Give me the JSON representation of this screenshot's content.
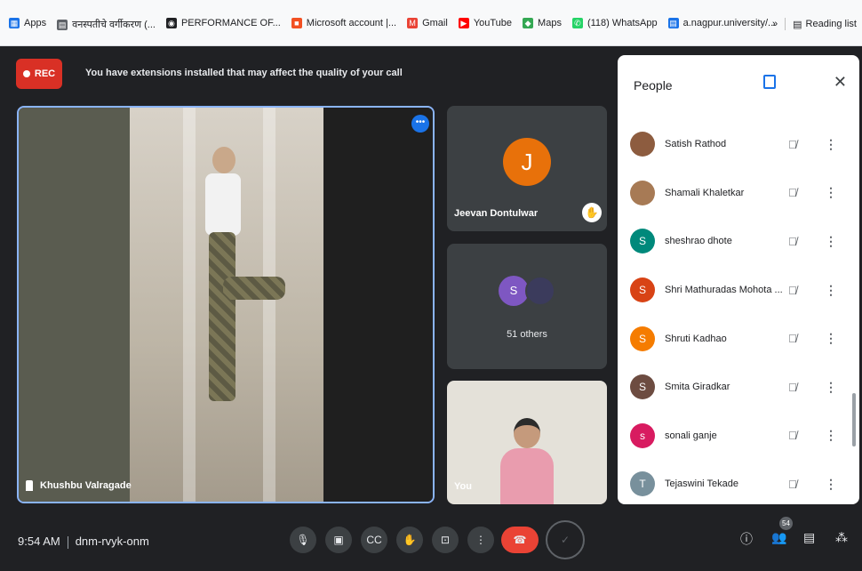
{
  "bookmarks": [
    {
      "label": "Apps",
      "icon": "apps-grid-icon",
      "color": "#1a73e8"
    },
    {
      "label": "वनस्पतीचे वर्गीकरण (...",
      "icon": "doc-icon",
      "color": "#5f6368"
    },
    {
      "label": "PERFORMANCE OF...",
      "icon": "globe-icon",
      "color": "#202124"
    },
    {
      "label": "Microsoft account |...",
      "icon": "microsoft-icon",
      "color": "#f25022"
    },
    {
      "label": "Gmail",
      "icon": "gmail-icon",
      "color": "#ea4335"
    },
    {
      "label": "YouTube",
      "icon": "youtube-icon",
      "color": "#ff0000"
    },
    {
      "label": "Maps",
      "icon": "maps-icon",
      "color": "#34a853"
    },
    {
      "label": "(118) WhatsApp",
      "icon": "whatsapp-icon",
      "color": "#25d366"
    },
    {
      "label": "a.nagpur.university/...",
      "icon": "doc-icon",
      "color": "#1a73e8"
    }
  ],
  "bookmarks_right": {
    "more": "»",
    "reading_list": "Reading list"
  },
  "meet": {
    "rec_label": "REC",
    "warning": "You have extensions installed that may affect the quality of your call",
    "main_tile": {
      "name": "Khushbu Valragade"
    },
    "tiles": [
      {
        "name": "Jeevan Dontulwar",
        "initial": "J",
        "color": "#e8710a"
      },
      {
        "others_label": "51 others",
        "initial": "S",
        "color": "#7e57c2"
      },
      {
        "name": "You"
      }
    ],
    "meeting_time": "9:54 AM",
    "meeting_code": "dnm-rvyk-onm",
    "participant_count": "54"
  },
  "people_panel": {
    "title": "People",
    "participants": [
      {
        "name": "Satish Rathod",
        "initial": "",
        "color": "#8d5c3f",
        "photo": true
      },
      {
        "name": "Shamali Khaletkar",
        "initial": "",
        "color": "#a77a55",
        "photo": true
      },
      {
        "name": "sheshrao dhote",
        "initial": "S",
        "color": "#00897b"
      },
      {
        "name": "Shri Mathuradas Mohota ...",
        "initial": "S",
        "color": "#d84315"
      },
      {
        "name": "Shruti Kadhao",
        "initial": "S",
        "color": "#f57c00"
      },
      {
        "name": "Smita Giradkar",
        "initial": "S",
        "color": "#6d4c41"
      },
      {
        "name": "sonali ganje",
        "initial": "s",
        "color": "#d81b60"
      },
      {
        "name": "Tejaswini Tekade",
        "initial": "T",
        "color": "#78909c"
      }
    ]
  }
}
